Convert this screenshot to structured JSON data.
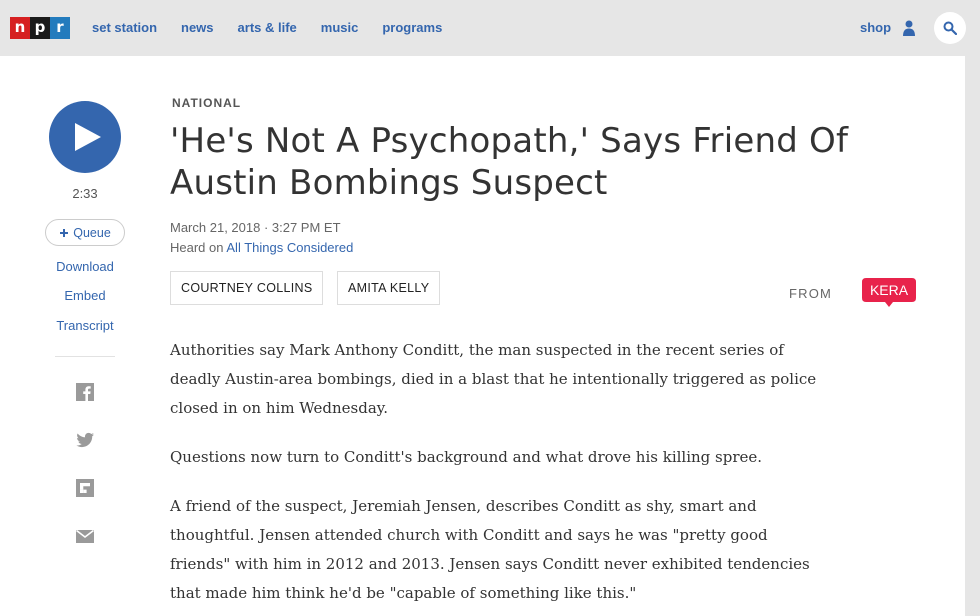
{
  "header": {
    "logo_letters": [
      "n",
      "p",
      "r"
    ],
    "nav": [
      "set station",
      "news",
      "arts & life",
      "music",
      "programs"
    ],
    "shop": "shop",
    "icons": [
      "user-icon",
      "search-icon"
    ],
    "colors": {
      "logo_n": "#d62021",
      "logo_p": "#1a1a1a",
      "logo_r": "#237bbd",
      "link": "#3466ae"
    }
  },
  "rail": {
    "duration": "2:33",
    "queue": "Queue",
    "links": [
      "Download",
      "Embed",
      "Transcript"
    ],
    "social_icons": [
      "facebook-icon",
      "twitter-icon",
      "flipboard-icon",
      "email-icon"
    ]
  },
  "article": {
    "section": "NATIONAL",
    "title": "'He's Not A Psychopath,' Says Friend Of Austin Bombings Suspect",
    "date": "March 21, 2018 · 3:27 PM ET",
    "heard_on_prefix": "Heard on",
    "heard_on_program": "All Things Considered",
    "bylines": [
      "COURTNEY COLLINS",
      "AMITA KELLY"
    ],
    "from_label": "FROM",
    "station": "KERA",
    "station_color": "#e8234b",
    "paragraphs": [
      "Authorities say Mark Anthony Conditt, the man suspected in the recent series of deadly Austin-area bombings, died in a blast that he intentionally triggered as police closed in on him Wednesday.",
      "Questions now turn to Conditt's background and what drove his killing spree.",
      "A friend of the suspect, Jeremiah Jensen, describes Conditt as shy, smart and thoughtful. Jensen attended church with Conditt and says he was \"pretty good friends\" with him in 2012 and 2013. Jensen says Conditt never exhibited tendencies that made him think he'd be \"capable of something like this.\""
    ]
  }
}
